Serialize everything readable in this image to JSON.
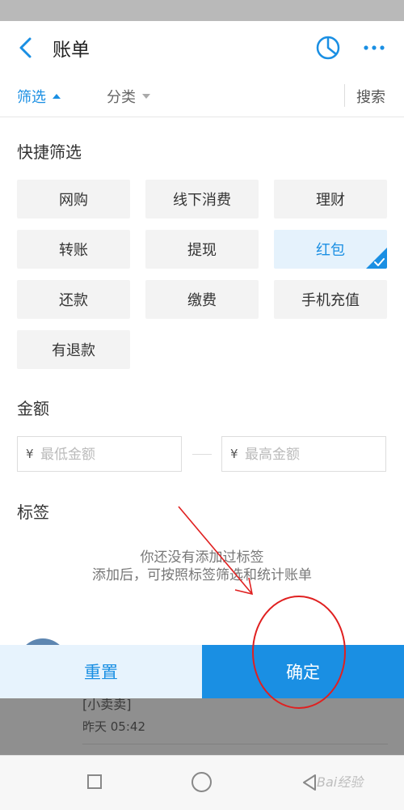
{
  "header": {
    "title": "账单"
  },
  "filter_bar": {
    "filter_label": "筛选",
    "category_label": "分类",
    "search_label": "搜索"
  },
  "quick_filter": {
    "title": "快捷筛选",
    "chips": [
      "网购",
      "线下消费",
      "理财",
      "转账",
      "提现",
      "红包",
      "还款",
      "缴费",
      "手机充值",
      "有退款"
    ],
    "selected": "红包"
  },
  "amount": {
    "title": "金额",
    "currency": "¥",
    "min_placeholder": "最低金额",
    "max_placeholder": "最高金额"
  },
  "tags": {
    "title": "标签",
    "empty_line1": "你还没有添加过标签",
    "empty_line2": "添加后，可按照标签筛选和统计账单"
  },
  "actions": {
    "reset_label": "重置",
    "confirm_label": "确定"
  },
  "background_item": {
    "name": "[小卖卖]",
    "time": "昨天  05:42"
  },
  "watermark": "Bai经验",
  "colors": {
    "accent": "#1a8fe3",
    "annotation": "#e02020"
  }
}
